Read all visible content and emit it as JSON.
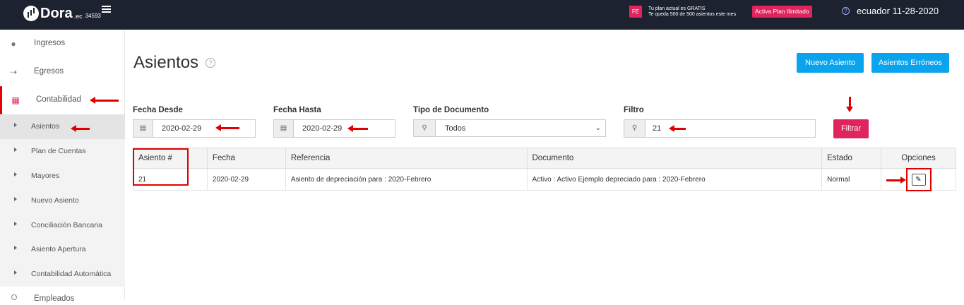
{
  "topbar": {
    "logo": "Dora",
    "logo_tld": ".ec",
    "company_id": "34593",
    "fe_badge": "FE",
    "plan_line1": "Tu plan actual es GRATIS",
    "plan_line2": "Te queda 500 de 500 asientos este mes",
    "plan_button": "Activa Plan Ilimitado",
    "help_icon_text": "?",
    "user_info": "ecuador 11-28-2020"
  },
  "sidebar": {
    "items": [
      {
        "label": "Ingresos",
        "icon": "piggy-icon"
      },
      {
        "label": "Egresos",
        "icon": "egress-icon"
      },
      {
        "label": "Contabilidad",
        "icon": "calculator-icon"
      }
    ],
    "subitems": [
      {
        "label": "Asientos"
      },
      {
        "label": "Plan de Cuentas"
      },
      {
        "label": "Mayores"
      },
      {
        "label": "Nuevo Asiento"
      },
      {
        "label": "Conciliación Bancaria"
      },
      {
        "label": "Asiento Apertura"
      },
      {
        "label": "Contabilidad Automática"
      }
    ],
    "next_item": "Empleados"
  },
  "page": {
    "title": "Asientos",
    "help_icon_text": "?",
    "new_button": "Nuevo Asiento",
    "errors_button": "Asientos Erróneos"
  },
  "filters": {
    "fecha_desde_label": "Fecha Desde",
    "fecha_desde_value": "2020-02-29",
    "fecha_hasta_label": "Fecha Hasta",
    "fecha_hasta_value": "2020-02-29",
    "tipo_label": "Tipo de Documento",
    "tipo_value": "Todos",
    "filtro_label": "Filtro",
    "filtro_value": "21",
    "filter_button": "Filtrar"
  },
  "table": {
    "headers": [
      "Asiento #",
      "Fecha",
      "Referencia",
      "Documento",
      "Estado",
      "Opciones"
    ],
    "rows": [
      [
        "21",
        "2020-02-29",
        "Asiento de depreciación para : 2020-Febrero",
        "Activo : Activo Ejemplo depreciado para : 2020-Febrero",
        "Normal"
      ]
    ]
  },
  "colors": {
    "topbar": "#1c2230",
    "accent": "#e0245e",
    "primary_button": "#0aa3ee",
    "annotation": "#e00000"
  }
}
